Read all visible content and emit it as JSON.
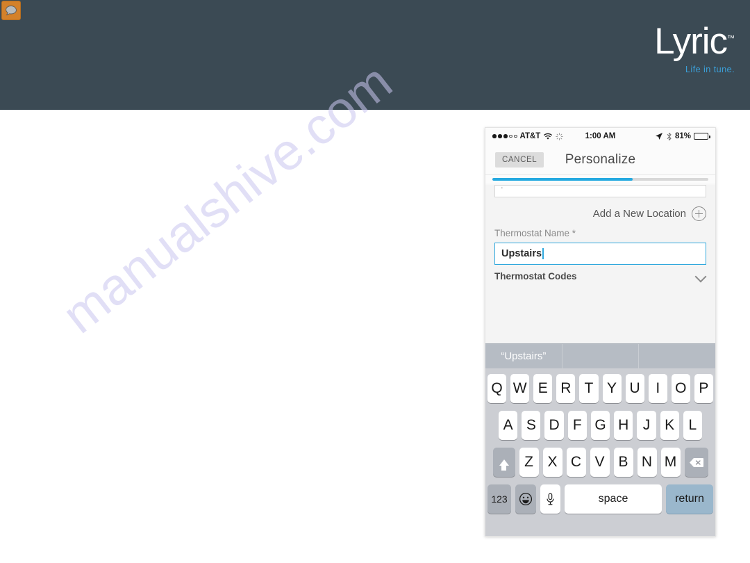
{
  "brand": {
    "corner_icon": "speech-bubble-icon",
    "corner_icon_bg": "#d4812a",
    "logo_text": "Lyric",
    "logo_tm": "™",
    "tagline": "Life in tune.",
    "tagline_color": "#3b9ed6",
    "header_bg": "#3b4a54"
  },
  "watermark": {
    "text": "manualshive.com",
    "color": "#c9c6ef"
  },
  "phone": {
    "status_bar": {
      "signal_dots_filled": 3,
      "signal_dots_empty": 2,
      "carrier": "AT&T",
      "wifi_icon": "wifi-icon",
      "activity_icon": "activity-spinner-icon",
      "time": "1:00 AM",
      "location_icon": "location-arrow-icon",
      "bluetooth_icon": "bluetooth-icon",
      "battery_percent": "81%",
      "battery_level": 81
    },
    "nav_bar": {
      "cancel_label": "CANCEL",
      "title": "Personalize"
    },
    "progress": {
      "percent": 65,
      "fill_color": "#25a9e0",
      "track_color": "#d8d8d8"
    },
    "form": {
      "add_location_label": "Add a New Location",
      "add_location_icon": "plus-circle-icon",
      "thermostat_name_label": "Thermostat Name *",
      "thermostat_name_value": "Upstairs",
      "thermostat_name_focus_color": "#2fa8dd",
      "thermostat_codes_label": "Thermostat Codes",
      "thermostat_codes_icon": "chevron-down-icon"
    },
    "keyboard": {
      "suggestions": [
        "“Upstairs”",
        "",
        ""
      ],
      "row1": [
        "Q",
        "W",
        "E",
        "R",
        "T",
        "Y",
        "U",
        "I",
        "O",
        "P"
      ],
      "row2": [
        "A",
        "S",
        "D",
        "F",
        "G",
        "H",
        "J",
        "K",
        "L"
      ],
      "row3": [
        "Z",
        "X",
        "C",
        "V",
        "B",
        "N",
        "M"
      ],
      "shift_icon": "shift-arrow-icon",
      "delete_icon": "backspace-icon",
      "numbers_label": "123",
      "emoji_icon": "smiley-face-icon",
      "mic_icon": "microphone-icon",
      "space_label": "space",
      "return_label": "return",
      "return_color": "#9ab7cc"
    }
  }
}
